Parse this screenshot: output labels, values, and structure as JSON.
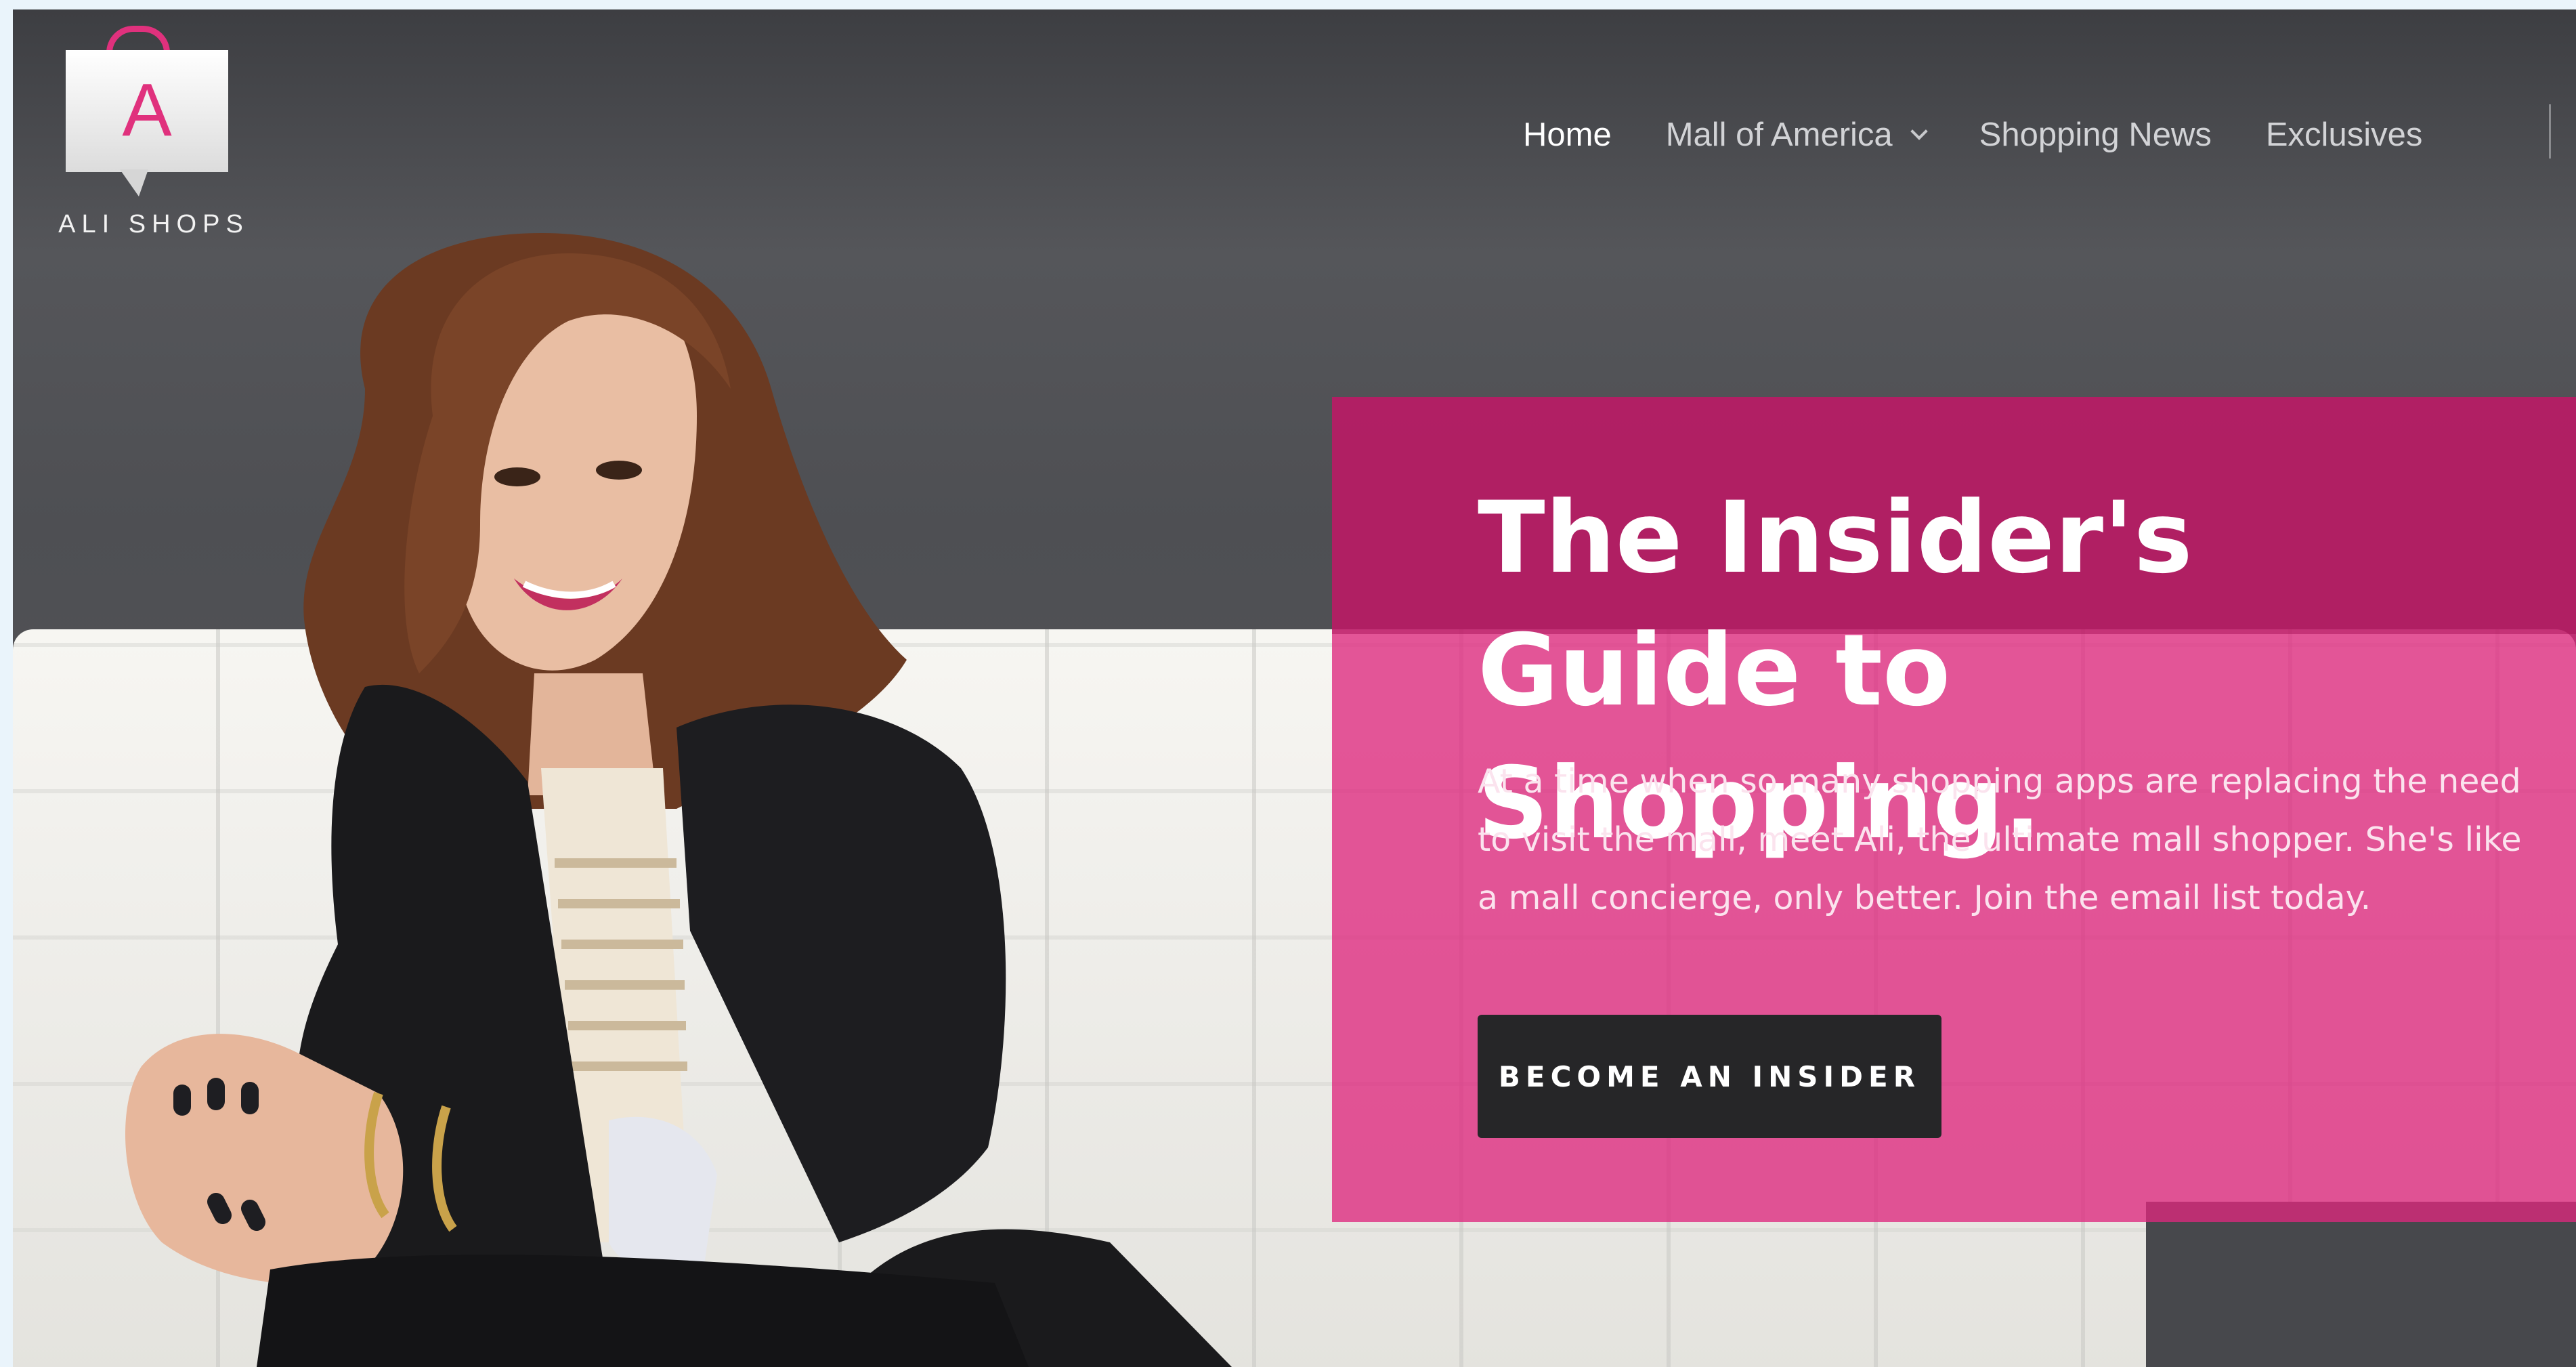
{
  "brand": {
    "logo_letter": "A",
    "name": "ALI SHOPS",
    "accent_color": "#e0317d"
  },
  "nav": {
    "items": [
      {
        "label": "Home",
        "active": true
      },
      {
        "label": "Mall of America",
        "has_dropdown": true,
        "icon": "chevron-down-icon"
      },
      {
        "label": "Shopping News"
      },
      {
        "label": "Exclusives"
      }
    ]
  },
  "hero": {
    "title": "The Insider's Guide to Shopping.",
    "body": "At a time when so many shopping apps are replacing the need to visit the mall, meet Ali, the ultimate mall shopper. She's like a mall concierge, only better. Join the email list today.",
    "cta_label": "BECOME AN INSIDER",
    "panel_color": "#de287e",
    "button_color": "#262628"
  },
  "background": {
    "image": "woman-smiling-on-white-sofa"
  }
}
